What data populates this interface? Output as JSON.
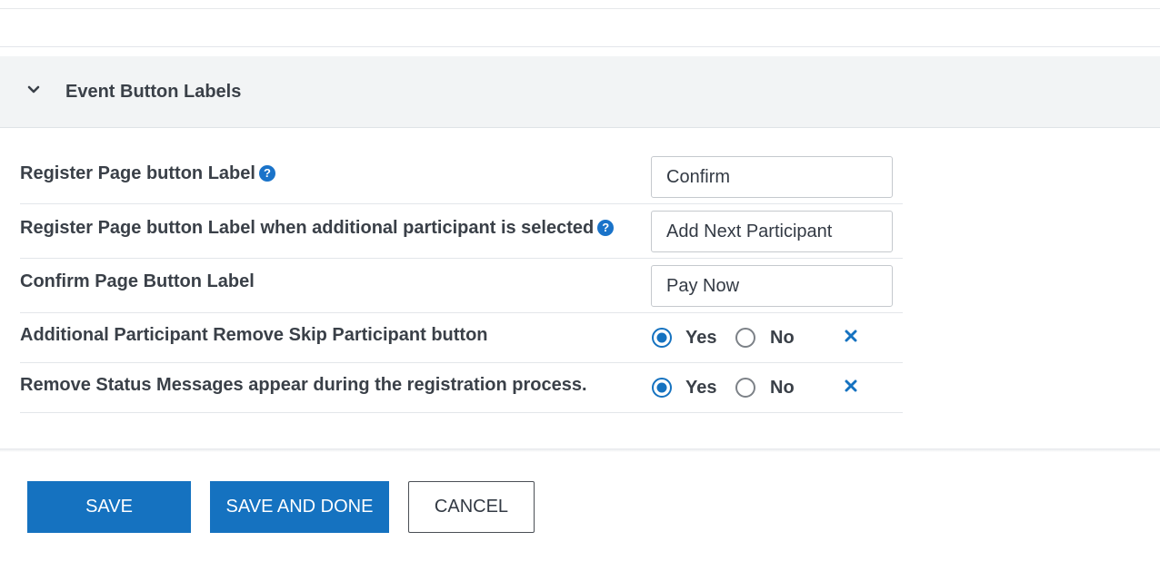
{
  "section": {
    "title": "Event Button Labels",
    "toggle_icon": "chevron-down-icon"
  },
  "fields": [
    {
      "label": "Register Page button Label",
      "help": true,
      "type": "text",
      "value": "Confirm"
    },
    {
      "label": "Register Page button Label when additional participant is selected",
      "help": true,
      "type": "text",
      "value": "Add Next Participant"
    },
    {
      "label": "Confirm Page Button Label",
      "help": false,
      "type": "text",
      "value": "Pay Now"
    },
    {
      "label": "Additional Participant Remove Skip Participant button",
      "type": "radio",
      "options": [
        "Yes",
        "No"
      ],
      "selected": "Yes"
    },
    {
      "label": "Remove Status Messages appear during the registration process.",
      "type": "radio",
      "options": [
        "Yes",
        "No"
      ],
      "selected": "Yes"
    }
  ],
  "help_glyph": "?",
  "buttons": {
    "save": "SAVE",
    "save_and_done": "SAVE AND DONE",
    "cancel": "CANCEL"
  },
  "colors": {
    "accent": "#1572c0",
    "help_icon": "#1a73c9",
    "section_bg": "#f2f4f5"
  }
}
